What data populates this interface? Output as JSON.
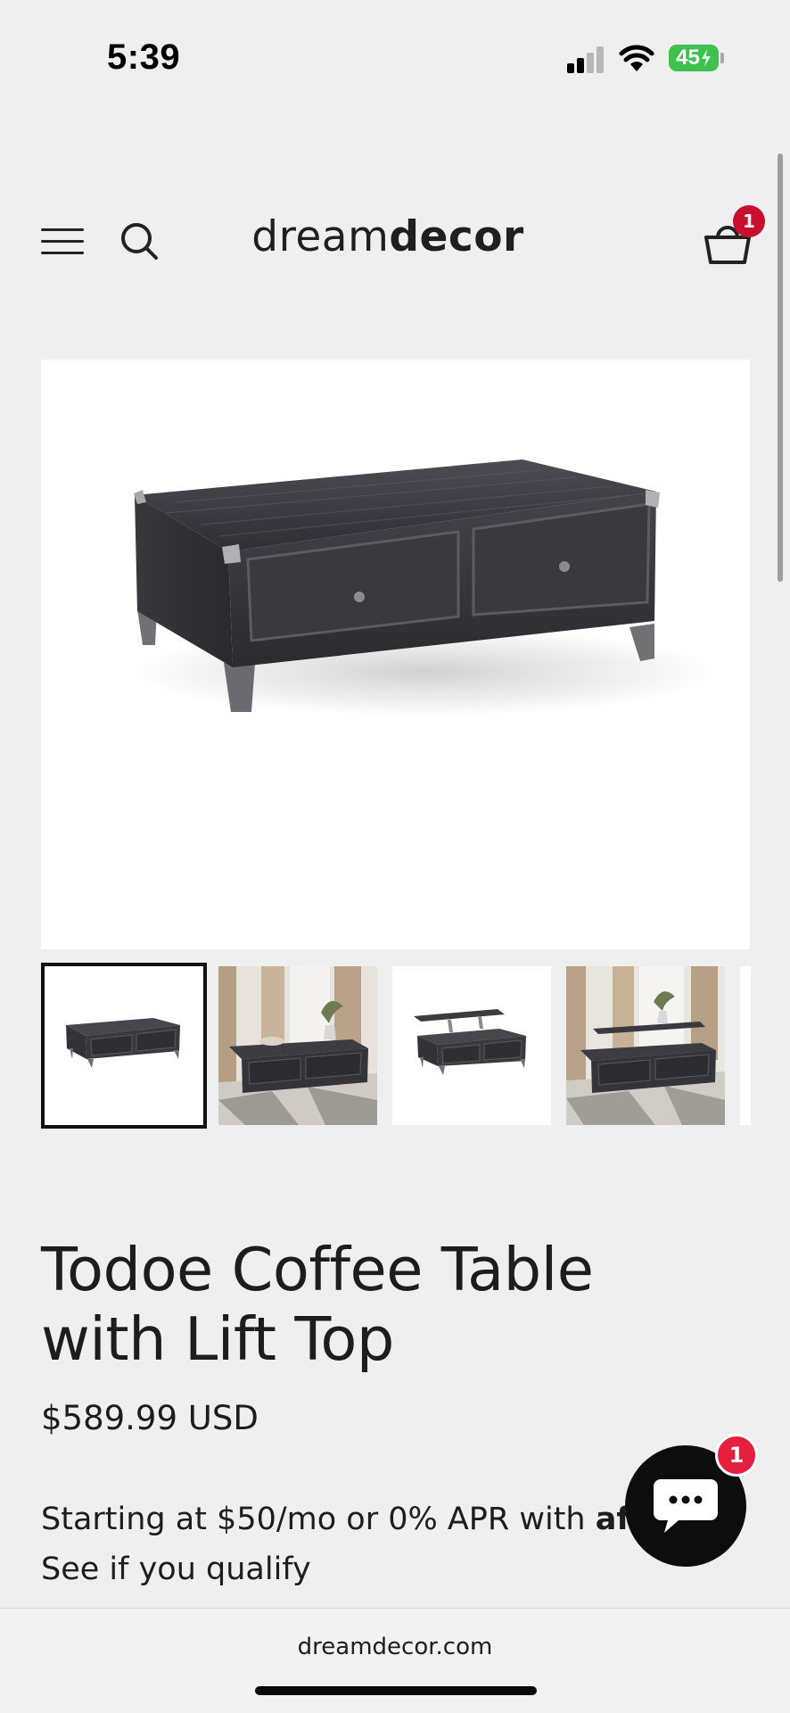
{
  "status_bar": {
    "time": "5:39",
    "battery_level": "45",
    "signal_bars_active": 2,
    "icons": [
      "cellular-signal-icon",
      "wifi-icon",
      "battery-charging-icon"
    ]
  },
  "header": {
    "logo_light": "dream",
    "logo_bold": "decor",
    "cart_count": "1",
    "icons": [
      "hamburger-menu-icon",
      "search-icon",
      "cart-icon"
    ]
  },
  "gallery": {
    "thumbnails": [
      {
        "kind": "studio-front",
        "selected": true
      },
      {
        "kind": "room-scene",
        "selected": false
      },
      {
        "kind": "lift-top-raised",
        "selected": false
      },
      {
        "kind": "room-scene-lifted",
        "selected": false
      }
    ]
  },
  "product": {
    "title": "Todoe Coffee Table with Lift Top",
    "price": "$589.99 USD",
    "financing_text": "Starting at $50/mo or 0% APR with ",
    "financing_brand": "affirm",
    "qualify_link": "See if you qualify"
  },
  "chat": {
    "badge_count": "1",
    "icon": "chat-bubble-icon"
  },
  "browser": {
    "url": "dreamdecor.com"
  },
  "colors": {
    "page_background": "#efefef",
    "badge_red": "#c8102e",
    "chat_badge_red": "#e5203f",
    "battery_green": "#3fc04f",
    "text_dark": "#1d1d1d"
  }
}
